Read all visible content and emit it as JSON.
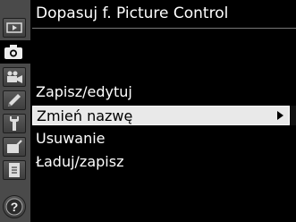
{
  "title": "Dopasuj f. Picture Control",
  "menu": {
    "items": [
      {
        "label": "Zapisz/edytuj",
        "selected": false
      },
      {
        "label": "Zmień nazwę",
        "selected": true,
        "has_submenu": true
      },
      {
        "label": "Usuwanie",
        "selected": false
      },
      {
        "label": "Ładuj/zapisz",
        "selected": false
      }
    ]
  },
  "sidebar": {
    "tabs": [
      {
        "icon": "playback-icon"
      },
      {
        "icon": "camera-icon",
        "active": true
      },
      {
        "icon": "movie-icon"
      },
      {
        "icon": "pencil-icon"
      },
      {
        "icon": "wrench-icon"
      },
      {
        "icon": "retouch-icon"
      },
      {
        "icon": "my-menu-icon"
      },
      {
        "icon": "help-icon"
      }
    ]
  },
  "colors": {
    "background": "#000000",
    "rail": "#4a4a4a",
    "highlight": "#e9e9e9",
    "text": "#ffffff"
  }
}
